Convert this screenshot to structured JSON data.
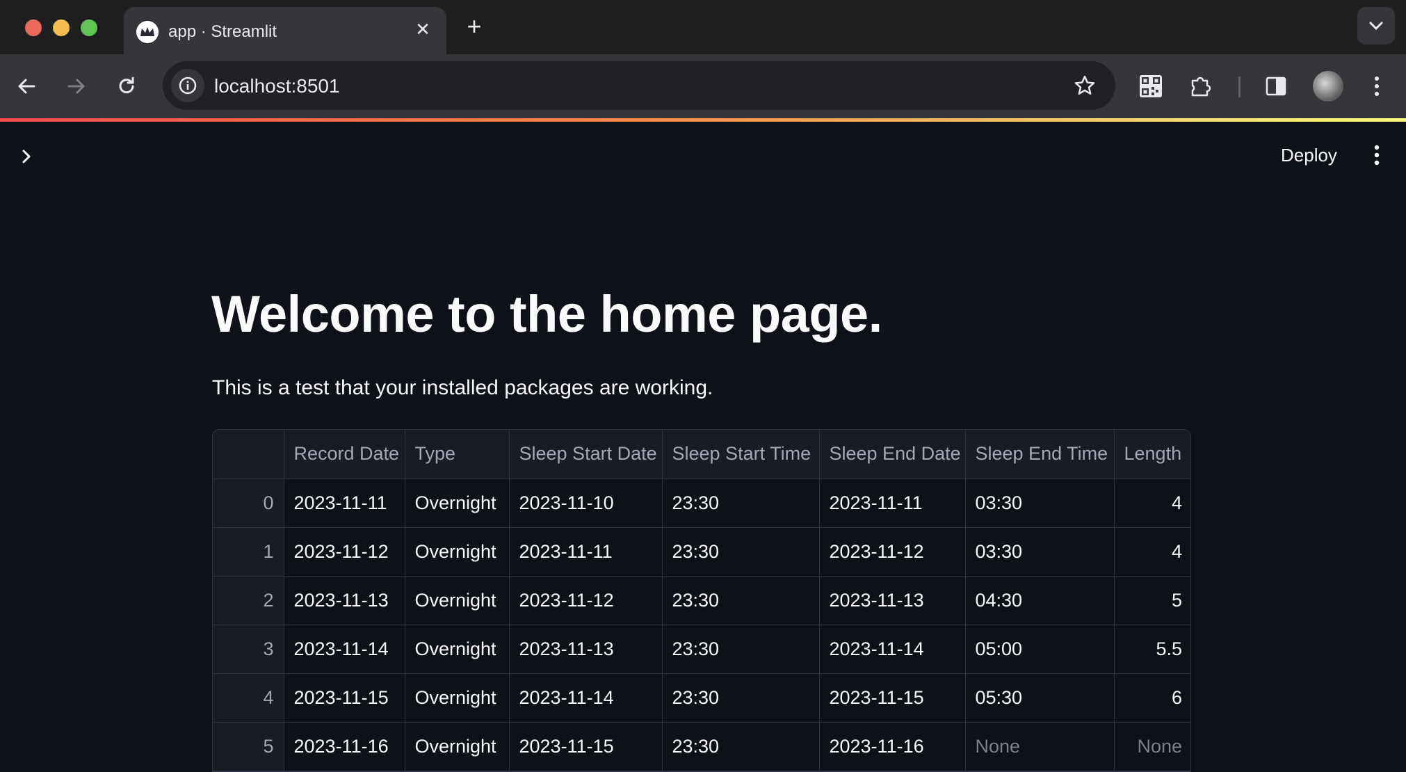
{
  "browser": {
    "tab_title": "app · Streamlit",
    "tab_close": "✕",
    "new_tab": "+",
    "url": "localhost:8501"
  },
  "app": {
    "deploy_label": "Deploy",
    "title": "Welcome to the home page.",
    "subtitle": "This is a test that your installed packages are working."
  },
  "dataframe": {
    "columns": [
      "",
      "Record Date",
      "Type",
      "Sleep Start Date",
      "Sleep Start Time",
      "Sleep End Date",
      "Sleep End Time",
      "Length"
    ],
    "rows": [
      [
        "0",
        "2023-11-11",
        "Overnight",
        "2023-11-10",
        "23:30",
        "2023-11-11",
        "03:30",
        "4"
      ],
      [
        "1",
        "2023-11-12",
        "Overnight",
        "2023-11-11",
        "23:30",
        "2023-11-12",
        "03:30",
        "4"
      ],
      [
        "2",
        "2023-11-13",
        "Overnight",
        "2023-11-12",
        "23:30",
        "2023-11-13",
        "04:30",
        "5"
      ],
      [
        "3",
        "2023-11-14",
        "Overnight",
        "2023-11-13",
        "23:30",
        "2023-11-14",
        "05:00",
        "5.5"
      ],
      [
        "4",
        "2023-11-15",
        "Overnight",
        "2023-11-14",
        "23:30",
        "2023-11-15",
        "05:30",
        "6"
      ],
      [
        "5",
        "2023-11-16",
        "Overnight",
        "2023-11-15",
        "23:30",
        "2023-11-16",
        "None",
        "None"
      ]
    ]
  },
  "colors": {
    "app_background": "#0e1117",
    "header_background": "#1a1c24",
    "accent_gradient_start": "#ff4b4b",
    "accent_gradient_end": "#fffd80"
  }
}
